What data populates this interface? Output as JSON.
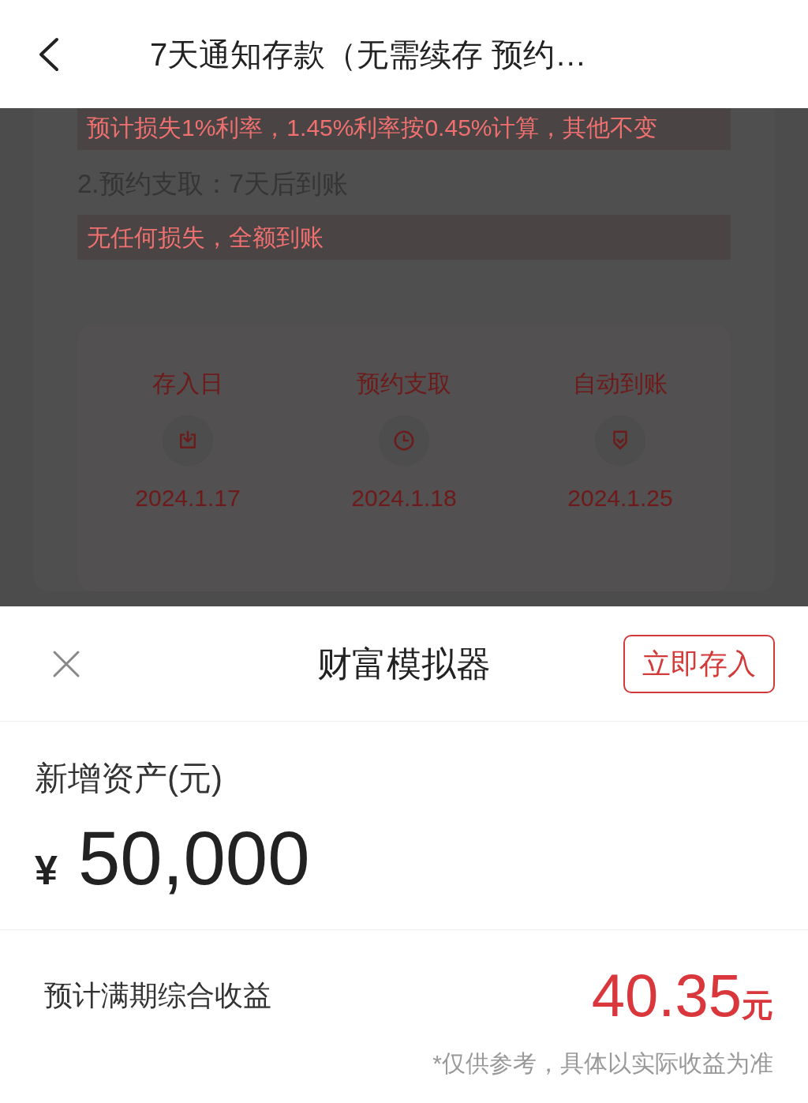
{
  "header": {
    "title": "7天通知存款（无需续存 预约…"
  },
  "background_content": {
    "lines": [
      {
        "kind": "highlight",
        "text": "预计损失1%利率，1.45%利率按0.45%计算，其他不变"
      },
      {
        "kind": "heading",
        "text": "2.预约支取：7天后到账"
      },
      {
        "kind": "highlight",
        "text": "无任何损失，全额到账"
      }
    ],
    "timeline": [
      {
        "label": "存入日",
        "kind": "deposit",
        "date": "2024.1.17"
      },
      {
        "label": "预约支取",
        "kind": "clock",
        "date": "2024.1.18"
      },
      {
        "label": "自动到账",
        "kind": "arrival",
        "date": "2024.1.25"
      }
    ]
  },
  "sheet": {
    "title": "财富模拟器",
    "action_button": "立即存入",
    "amount_label": "新增资产(元)",
    "currency": "¥",
    "amount": "50,000",
    "income_label": "预计满期综合收益",
    "income_value": "40.35",
    "income_unit": "元",
    "note": "*仅供参考，具体以实际收益为准"
  }
}
